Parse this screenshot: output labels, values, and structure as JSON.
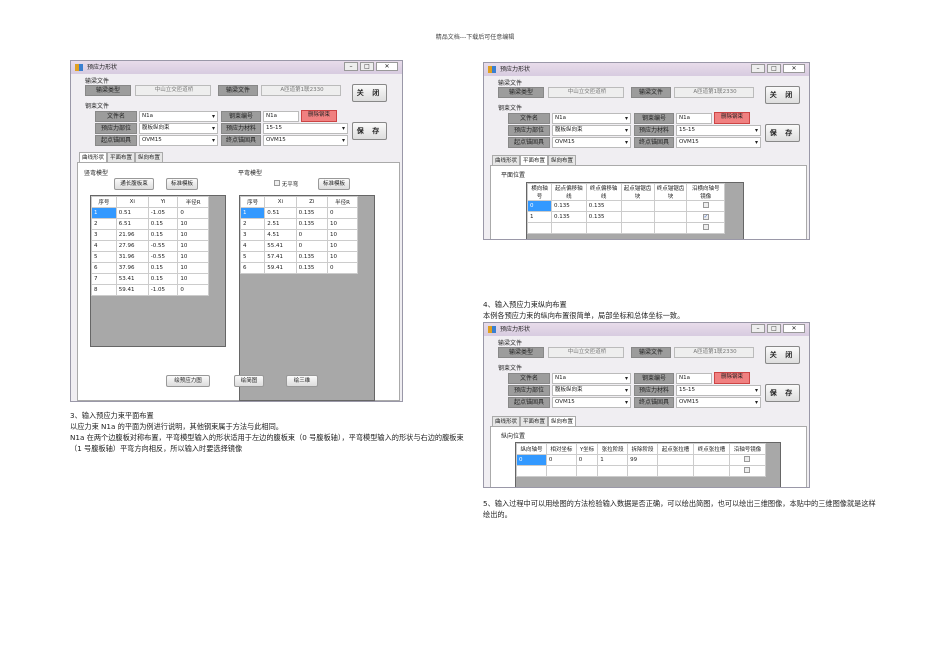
{
  "header": "精品文档---下载后可任意编辑",
  "dialog": {
    "title": "预应力形状",
    "group_bridge": "输梁文件",
    "bridge_type_label": "输梁类型",
    "bridge_type_value": "中山立交匝道桥",
    "bridge_file_label": "输梁文件",
    "bridge_file_value": "A匝道第1联2330",
    "group_tendon": "钢束文件",
    "file_name_label": "文件名",
    "file_name_value": "N1a",
    "tendon_no_label": "钢束编号",
    "tendon_no_value": "N1a",
    "delete_label": "删除钢束",
    "position_label": "预应力部位",
    "position_value": "腹板纵向束",
    "material_label": "预应力材料",
    "material_value": "15-15",
    "start_anchor_label": "起点锚固具",
    "start_anchor_value": "OVM15",
    "end_anchor_label": "终点锚固具",
    "end_anchor_value": "OVM15",
    "close_label": "关 闭",
    "save_label": "保 存",
    "tabs": [
      "曲线形状",
      "平面布置",
      "纵向布置"
    ]
  },
  "shape_tab": {
    "vertical_group": "竖弯模型",
    "btn_long": "通长腹板束",
    "btn_std1": "标准模板",
    "horizontal_group": "平弯模型",
    "no_bend_label": "无平弯",
    "btn_std2": "标准模板",
    "vertical_headers": [
      "序号",
      "Xi",
      "Yi",
      "半径R"
    ],
    "vertical_rows": [
      [
        "1",
        "0.51",
        "-1.05",
        "0"
      ],
      [
        "2",
        "6.51",
        "0.15",
        "10"
      ],
      [
        "3",
        "21.96",
        "0.15",
        "10"
      ],
      [
        "4",
        "27.96",
        "-0.55",
        "10"
      ],
      [
        "5",
        "31.96",
        "-0.55",
        "10"
      ],
      [
        "6",
        "37.96",
        "0.15",
        "10"
      ],
      [
        "7",
        "53.41",
        "0.15",
        "10"
      ],
      [
        "8",
        "59.41",
        "-1.05",
        "0"
      ]
    ],
    "horizontal_headers": [
      "序号",
      "Xi",
      "Zi",
      "半径R"
    ],
    "horizontal_rows": [
      [
        "1",
        "0.51",
        "0.135",
        "0"
      ],
      [
        "2",
        "2.51",
        "0.135",
        "10"
      ],
      [
        "3",
        "4.51",
        "0",
        "10"
      ],
      [
        "4",
        "55.41",
        "0",
        "10"
      ],
      [
        "5",
        "57.41",
        "0.135",
        "10"
      ],
      [
        "6",
        "59.41",
        "0.135",
        "0"
      ]
    ],
    "btn_draw_stress": "绘预应力图",
    "btn_draw_simple": "绘简图",
    "btn_draw_3d": "绘三维"
  },
  "plan_tab": {
    "group": "平面位置",
    "headers": [
      "横向轴号",
      "起点偏移轴线",
      "终点偏移轴线",
      "起点锚锯齿块",
      "终点锚锯齿块",
      "沿横向轴号镜像"
    ],
    "rows": [
      [
        "0",
        "0.135",
        "0.135",
        "",
        "",
        false
      ],
      [
        "1",
        "0.135",
        "0.135",
        "",
        "",
        true
      ],
      [
        "",
        "",
        "",
        "",
        "",
        false
      ]
    ]
  },
  "long_tab": {
    "group": "纵向位置",
    "headers": [
      "纵向轴号",
      "相对坐标",
      "Y坐标",
      "张拉阶段",
      "拆除阶段",
      "起点张拉槽",
      "终点张拉槽",
      "沿轴号镜像"
    ],
    "rows": [
      [
        "0",
        "0",
        "0",
        "1",
        "99",
        "",
        "",
        false
      ],
      [
        "",
        "",
        "",
        "",
        "",
        "",
        "",
        false
      ]
    ]
  },
  "text": {
    "s3_title": "3、输入预应力束平面布置",
    "s3_p1": "以应力束 N1a 的平面为例进行说明，其他钢束属于方法与此相同。",
    "s3_p2": "N1a 在两个边腹板对称布置，平弯模型输入的形状适用于左边的腹板束（0 号腹板轴），平弯模型输入的形状与右边的腹板束（1 号腹板轴）平弯方向相反，所以输入时要选择镜像",
    "s4_title": "4、输入预应力束纵向布置",
    "s4_p1": "本例各预应力束的纵向布置很简单，局部坐标和总体坐标一致。",
    "s5_p1": "5、输入过程中可以用绘图的方法检验输入数据是否正确，可以绘出简图，也可以绘出三维图像，本贴中的三维图像就是这样绘出的。"
  }
}
